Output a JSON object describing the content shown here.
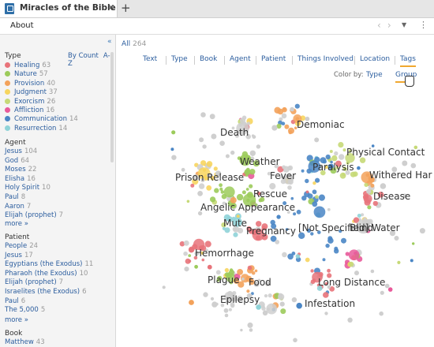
{
  "tab": {
    "title": "Miracles of the Bible",
    "close": "✕",
    "new": "+"
  },
  "toolbar": {
    "about": "About"
  },
  "sidebar": {
    "type_header": "Type",
    "sort_by_count": "By Count",
    "sort_az": "A-Z",
    "types": [
      {
        "label": "Healing",
        "count": "63",
        "color": "#e8737a"
      },
      {
        "label": "Nature",
        "count": "57",
        "color": "#9ccb5b"
      },
      {
        "label": "Provision",
        "count": "40",
        "color": "#f3a25b"
      },
      {
        "label": "Judgment",
        "count": "37",
        "color": "#f7d55e"
      },
      {
        "label": "Exorcism",
        "count": "26",
        "color": "#c6d977"
      },
      {
        "label": "Affliction",
        "count": "16",
        "color": "#e85a9a"
      },
      {
        "label": "Communication",
        "count": "14",
        "color": "#4a86c5"
      },
      {
        "label": "Resurrection",
        "count": "14",
        "color": "#8fd3d8"
      }
    ],
    "agent_header": "Agent",
    "agents": [
      {
        "label": "Jesus",
        "count": "104"
      },
      {
        "label": "God",
        "count": "64"
      },
      {
        "label": "Moses",
        "count": "22"
      },
      {
        "label": "Elisha",
        "count": "16"
      },
      {
        "label": "Holy Spirit",
        "count": "10"
      },
      {
        "label": "Paul",
        "count": "8"
      },
      {
        "label": "Aaron",
        "count": "7"
      },
      {
        "label": "Elijah (prophet)",
        "count": "7"
      }
    ],
    "agent_more": "more »",
    "patient_header": "Patient",
    "patients": [
      {
        "label": "People",
        "count": "24"
      },
      {
        "label": "Jesus",
        "count": "17"
      },
      {
        "label": "Egyptians (the Exodus)",
        "count": "11"
      },
      {
        "label": "Pharaoh (the Exodus)",
        "count": "10"
      },
      {
        "label": "Elijah (prophet)",
        "count": "7"
      },
      {
        "label": "Israelites (the Exodus)",
        "count": "6"
      },
      {
        "label": "Paul",
        "count": "6"
      },
      {
        "label": "The 5,000",
        "count": "5"
      }
    ],
    "patient_more": "more »",
    "book_header": "Book",
    "books": [
      {
        "label": "Matthew",
        "count": "43"
      }
    ]
  },
  "main": {
    "all_label": "All",
    "all_count": "264",
    "filters": [
      "Text",
      "Type",
      "Book",
      "Agent",
      "Patient",
      "Things Involved",
      "Location",
      "Tags"
    ],
    "color_by_label": "Color by:",
    "color_by_options": [
      "Type",
      "Group"
    ]
  },
  "clusters": [
    "Death",
    "Demoniac",
    "Weather",
    "Physical Contact",
    "Paralysis",
    "Fever",
    "Prison Release",
    "Withered Har",
    "Rescue",
    "Disease",
    "Angelic Appearance",
    "Mute",
    "Pregnancy",
    "[Not Specified] Water",
    "Blind",
    "Hemorrhage",
    "Plague",
    "Food",
    "Long Distance",
    "Epilepsy",
    "Infestation"
  ],
  "colors": {
    "accent": "#f0a830",
    "link": "#2b5d9e",
    "healing": "#e8737a",
    "nature": "#9ccb5b",
    "provision": "#f3a25b",
    "judgment": "#f7d55e",
    "exorcism": "#c6d977",
    "affliction": "#e85a9a",
    "communication": "#4a86c5",
    "resurrection": "#8fd3d8",
    "other": "#cfcfcf"
  }
}
